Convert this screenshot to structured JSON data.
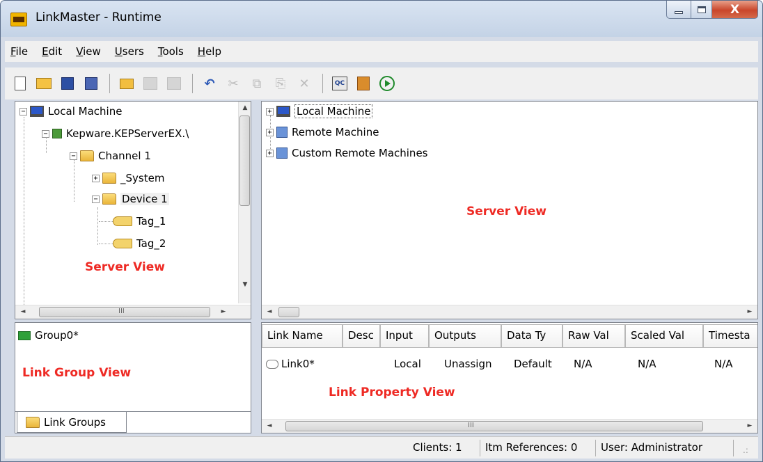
{
  "window": {
    "title": "LinkMaster - Runtime",
    "close_glyph": "X"
  },
  "menu": [
    {
      "accel": "F",
      "rest": "ile"
    },
    {
      "accel": "E",
      "rest": "dit"
    },
    {
      "accel": "V",
      "rest": "iew"
    },
    {
      "accel": "U",
      "rest": "sers"
    },
    {
      "accel": "T",
      "rest": "ools"
    },
    {
      "accel": "H",
      "rest": "elp"
    }
  ],
  "toolbar": {
    "undo": "↶",
    "cut": "✂",
    "copy": "⧉",
    "paste": "⎘",
    "delete": "✕",
    "qc": "QC"
  },
  "left_tree": {
    "items": [
      "Local Machine",
      "Kepware.KEPServerEX.\\",
      "Channel 1",
      "_System",
      "Device 1",
      "Tag_1",
      "Tag_2"
    ],
    "overlay_label": "Server View"
  },
  "right_tree": {
    "items": [
      "Local Machine",
      "Remote Machine",
      "Custom Remote Machines"
    ],
    "overlay_label": "Server View"
  },
  "link_groups": {
    "items": [
      "Group0*"
    ],
    "overlay_label": "Link Group View",
    "tab_label": "Link Groups"
  },
  "link_properties": {
    "columns": [
      "Link Name",
      "Desc",
      "Input",
      "Outputs",
      "Data Ty",
      "Raw Val",
      "Scaled Val",
      "Timesta"
    ],
    "rows": [
      {
        "name": "Link0*",
        "desc": "",
        "input": "Local",
        "outputs": "Unassign",
        "data_type": "Default",
        "raw": "N/A",
        "scaled": "N/A",
        "timestamp": "N/A"
      }
    ],
    "overlay_label": "Link Property View",
    "hscroll_mid": "III"
  },
  "scroll": {
    "up": "▲",
    "down": "▼",
    "left": "◄",
    "right": "►",
    "mid": "III"
  },
  "status": {
    "clients": "Clients: 1",
    "item_refs": "Itm References: 0",
    "user": "User: Administrator",
    "grip": ".:"
  }
}
